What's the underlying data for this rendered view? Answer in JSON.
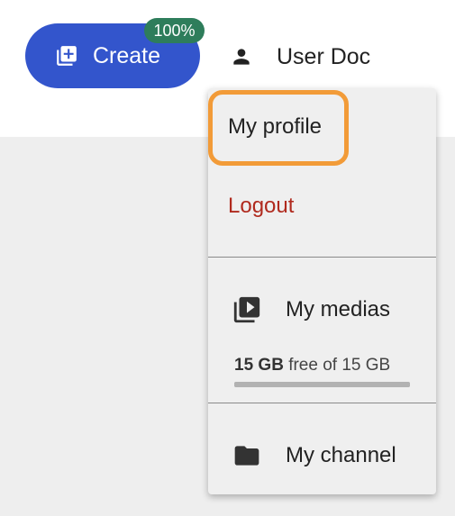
{
  "header": {
    "create_button": {
      "label": "Create",
      "icon": "add-to-queue-icon",
      "color": "#3355cc"
    },
    "upload_badge": "100%",
    "user": {
      "name": "User Doc",
      "icon": "person-icon"
    }
  },
  "user_menu": {
    "items": [
      {
        "label": "My profile",
        "highlighted": true,
        "highlight_color": "#f29b38"
      },
      {
        "label": "Logout",
        "color": "#b02a1e"
      }
    ],
    "medias": {
      "label": "My medias",
      "icon": "video-library-icon"
    },
    "storage": {
      "used": "15 GB",
      "text": "free of 15 GB",
      "fill_fraction": 1.0
    },
    "channel": {
      "label": "My channel",
      "icon": "folder-icon"
    }
  }
}
